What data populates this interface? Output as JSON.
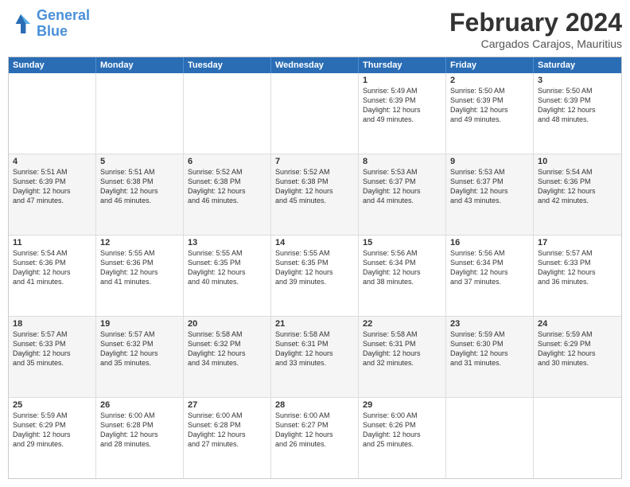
{
  "logo": {
    "line1": "General",
    "line2": "Blue"
  },
  "title": "February 2024",
  "subtitle": "Cargados Carajos, Mauritius",
  "days_of_week": [
    "Sunday",
    "Monday",
    "Tuesday",
    "Wednesday",
    "Thursday",
    "Friday",
    "Saturday"
  ],
  "rows": [
    {
      "alt": false,
      "cells": [
        {
          "day": "",
          "info": ""
        },
        {
          "day": "",
          "info": ""
        },
        {
          "day": "",
          "info": ""
        },
        {
          "day": "",
          "info": ""
        },
        {
          "day": "1",
          "info": "Sunrise: 5:49 AM\nSunset: 6:39 PM\nDaylight: 12 hours\nand 49 minutes."
        },
        {
          "day": "2",
          "info": "Sunrise: 5:50 AM\nSunset: 6:39 PM\nDaylight: 12 hours\nand 49 minutes."
        },
        {
          "day": "3",
          "info": "Sunrise: 5:50 AM\nSunset: 6:39 PM\nDaylight: 12 hours\nand 48 minutes."
        }
      ]
    },
    {
      "alt": true,
      "cells": [
        {
          "day": "4",
          "info": "Sunrise: 5:51 AM\nSunset: 6:39 PM\nDaylight: 12 hours\nand 47 minutes."
        },
        {
          "day": "5",
          "info": "Sunrise: 5:51 AM\nSunset: 6:38 PM\nDaylight: 12 hours\nand 46 minutes."
        },
        {
          "day": "6",
          "info": "Sunrise: 5:52 AM\nSunset: 6:38 PM\nDaylight: 12 hours\nand 46 minutes."
        },
        {
          "day": "7",
          "info": "Sunrise: 5:52 AM\nSunset: 6:38 PM\nDaylight: 12 hours\nand 45 minutes."
        },
        {
          "day": "8",
          "info": "Sunrise: 5:53 AM\nSunset: 6:37 PM\nDaylight: 12 hours\nand 44 minutes."
        },
        {
          "day": "9",
          "info": "Sunrise: 5:53 AM\nSunset: 6:37 PM\nDaylight: 12 hours\nand 43 minutes."
        },
        {
          "day": "10",
          "info": "Sunrise: 5:54 AM\nSunset: 6:36 PM\nDaylight: 12 hours\nand 42 minutes."
        }
      ]
    },
    {
      "alt": false,
      "cells": [
        {
          "day": "11",
          "info": "Sunrise: 5:54 AM\nSunset: 6:36 PM\nDaylight: 12 hours\nand 41 minutes."
        },
        {
          "day": "12",
          "info": "Sunrise: 5:55 AM\nSunset: 6:36 PM\nDaylight: 12 hours\nand 41 minutes."
        },
        {
          "day": "13",
          "info": "Sunrise: 5:55 AM\nSunset: 6:35 PM\nDaylight: 12 hours\nand 40 minutes."
        },
        {
          "day": "14",
          "info": "Sunrise: 5:55 AM\nSunset: 6:35 PM\nDaylight: 12 hours\nand 39 minutes."
        },
        {
          "day": "15",
          "info": "Sunrise: 5:56 AM\nSunset: 6:34 PM\nDaylight: 12 hours\nand 38 minutes."
        },
        {
          "day": "16",
          "info": "Sunrise: 5:56 AM\nSunset: 6:34 PM\nDaylight: 12 hours\nand 37 minutes."
        },
        {
          "day": "17",
          "info": "Sunrise: 5:57 AM\nSunset: 6:33 PM\nDaylight: 12 hours\nand 36 minutes."
        }
      ]
    },
    {
      "alt": true,
      "cells": [
        {
          "day": "18",
          "info": "Sunrise: 5:57 AM\nSunset: 6:33 PM\nDaylight: 12 hours\nand 35 minutes."
        },
        {
          "day": "19",
          "info": "Sunrise: 5:57 AM\nSunset: 6:32 PM\nDaylight: 12 hours\nand 35 minutes."
        },
        {
          "day": "20",
          "info": "Sunrise: 5:58 AM\nSunset: 6:32 PM\nDaylight: 12 hours\nand 34 minutes."
        },
        {
          "day": "21",
          "info": "Sunrise: 5:58 AM\nSunset: 6:31 PM\nDaylight: 12 hours\nand 33 minutes."
        },
        {
          "day": "22",
          "info": "Sunrise: 5:58 AM\nSunset: 6:31 PM\nDaylight: 12 hours\nand 32 minutes."
        },
        {
          "day": "23",
          "info": "Sunrise: 5:59 AM\nSunset: 6:30 PM\nDaylight: 12 hours\nand 31 minutes."
        },
        {
          "day": "24",
          "info": "Sunrise: 5:59 AM\nSunset: 6:29 PM\nDaylight: 12 hours\nand 30 minutes."
        }
      ]
    },
    {
      "alt": false,
      "cells": [
        {
          "day": "25",
          "info": "Sunrise: 5:59 AM\nSunset: 6:29 PM\nDaylight: 12 hours\nand 29 minutes."
        },
        {
          "day": "26",
          "info": "Sunrise: 6:00 AM\nSunset: 6:28 PM\nDaylight: 12 hours\nand 28 minutes."
        },
        {
          "day": "27",
          "info": "Sunrise: 6:00 AM\nSunset: 6:28 PM\nDaylight: 12 hours\nand 27 minutes."
        },
        {
          "day": "28",
          "info": "Sunrise: 6:00 AM\nSunset: 6:27 PM\nDaylight: 12 hours\nand 26 minutes."
        },
        {
          "day": "29",
          "info": "Sunrise: 6:00 AM\nSunset: 6:26 PM\nDaylight: 12 hours\nand 25 minutes."
        },
        {
          "day": "",
          "info": ""
        },
        {
          "day": "",
          "info": ""
        }
      ]
    }
  ]
}
